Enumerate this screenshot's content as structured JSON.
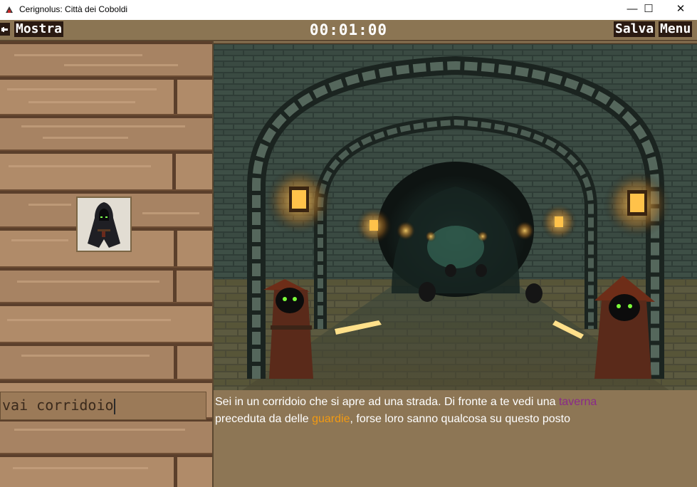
{
  "window": {
    "title": "Cerignolus: Città dei Coboldi",
    "minimize_glyph": "—",
    "maximize_glyph": "☐",
    "close_glyph": "✕"
  },
  "toolbar": {
    "back_icon": "arrow-left-icon",
    "show_label": "Mostra",
    "timer": "00:01:00",
    "save_label": "Salva",
    "menu_label": "Menu"
  },
  "player": {
    "avatar_icon": "hooded-figure-icon"
  },
  "command": {
    "value": "vai corridoio"
  },
  "story": {
    "part1": "Sei in un corridoio che si apre ad una strada. Di fronte a te vedi una ",
    "taverna": "taverna",
    "part2": "preceduta da delle ",
    "guardie": "guardie",
    "part3": ", forse loro sanno qualcosa su questo posto",
    "taverna_color": "#8a2a88",
    "guardie_color": "#f29a12"
  },
  "scene": {
    "description_icon": "dungeon-corridor-image"
  }
}
